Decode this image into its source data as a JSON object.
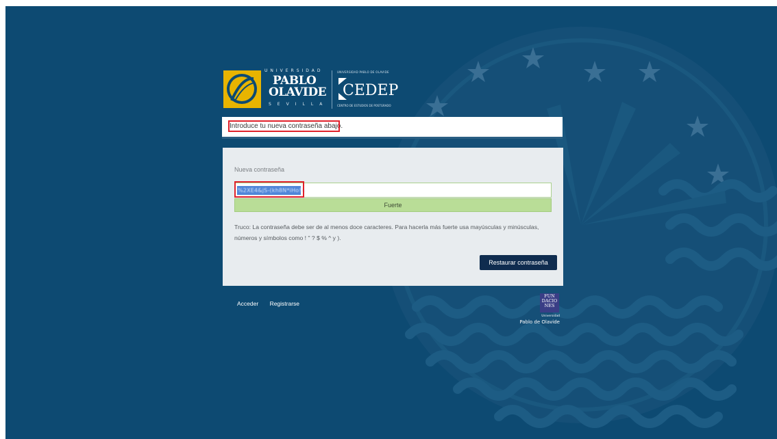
{
  "branding": {
    "university_top": "UNIVERSIDAD",
    "university_line1": "PABLO",
    "university_line2": "OLAVIDE",
    "university_bottom": "SEVILLA",
    "cedep_top": "UNIVERSIDAD PABLO DE OLAVIDE",
    "cedep_name": "CEDEP",
    "cedep_bottom": "CENTRO DE ESTUDIOS DE POSTGRADO",
    "fundaciones_mark": "FUN DACIO NES",
    "fundaciones_uni": "Universidad",
    "fundaciones_name": "Pablo de Olavide"
  },
  "message": {
    "text": "Introduce tu nueva contraseña abajo."
  },
  "form": {
    "password_label": "Nueva contraseña",
    "password_value": "%2XE4&jS-(kh8N*iHo!A",
    "strength_label": "Fuerte",
    "strength_level": "strong",
    "hint": "Truco: La contraseña debe ser de al menos doce caracteres. Para hacerla más fuerte usa mayúsculas y minúsculas, números y símbolos como ! \" ? $ % ^ y ).",
    "submit_label": "Restaurar contraseña"
  },
  "footer": {
    "login_link": "Acceder",
    "register_link": "Registrarse"
  },
  "colors": {
    "background": "#0d4a72",
    "panel": "#e8ecef",
    "strength_fill": "#b9dd97",
    "button": "#0f2c4f",
    "annotation": "#e0202a",
    "brand_gold": "#e8b400"
  }
}
